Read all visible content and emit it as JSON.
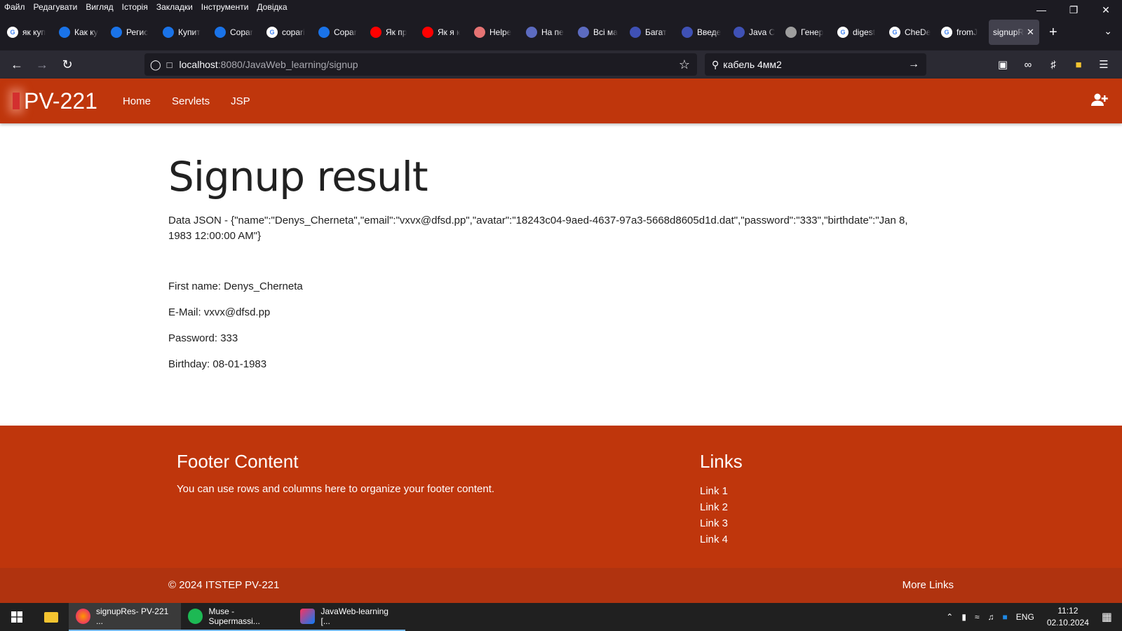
{
  "menu": [
    "Файл",
    "Редагувати",
    "Вигляд",
    "Історія",
    "Закладки",
    "Інструменти",
    "Довідка"
  ],
  "tabs": [
    {
      "title": "як куп",
      "color": "#ffffff",
      "icon": "google-icon"
    },
    {
      "title": "Как ку",
      "color": "#1a73e8",
      "icon": "copilot-c-icon"
    },
    {
      "title": "Регис",
      "color": "#1a73e8",
      "icon": "copilot-c-icon"
    },
    {
      "title": "Купит",
      "color": "#1a73e8",
      "icon": "copilot-c-icon"
    },
    {
      "title": "Copar",
      "color": "#1a73e8",
      "icon": "copilot-c-icon"
    },
    {
      "title": "copari",
      "color": "#ffffff",
      "icon": "google-icon"
    },
    {
      "title": "Copar",
      "color": "#1a73e8",
      "icon": "copilot-c-icon"
    },
    {
      "title": "Як пр",
      "color": "#ff0000",
      "icon": "youtube-icon"
    },
    {
      "title": "Як я к",
      "color": "#ff0000",
      "icon": "youtube-icon"
    },
    {
      "title": "Helpe",
      "color": "#e57373",
      "icon": "helper-icon"
    },
    {
      "title": "На пе",
      "color": "#5c6bc0",
      "icon": "m-icon"
    },
    {
      "title": "Всі ма",
      "color": "#5c6bc0",
      "icon": "m-icon"
    },
    {
      "title": "Багат",
      "color": "#3f51b5",
      "icon": "factory-icon"
    },
    {
      "title": "Введе",
      "color": "#3f51b5",
      "icon": "factory-icon"
    },
    {
      "title": "Java C",
      "color": "#3f51b5",
      "icon": "factory-icon"
    },
    {
      "title": "Генер",
      "color": "#9e9e9e",
      "icon": "openai-icon"
    },
    {
      "title": "digest",
      "color": "#ffffff",
      "icon": "google-icon"
    },
    {
      "title": "CheDe",
      "color": "#ffffff",
      "icon": "github-icon"
    },
    {
      "title": "fromJ",
      "color": "#ffffff",
      "icon": "google-icon"
    },
    {
      "title": "signupR",
      "color": "",
      "icon": ""
    }
  ],
  "address": {
    "host": "localhost",
    "path": ":8080/JavaWeb_learning/signup"
  },
  "search": {
    "query": "кабель 4мм2"
  },
  "site": {
    "brand": "PV-221",
    "nav": [
      "Home",
      "Servlets",
      "JSP"
    ],
    "accent": "#bf360c"
  },
  "page": {
    "title": "Signup result",
    "json_text": "Data JSON - {\"name\":\"Denys_Cherneta\",\"email\":\"vxvx@dfsd.pp\",\"avatar\":\"18243c04-9aed-4637-97a3-5668d8605d1d.dat\",\"password\":\"333\",\"birthdate\":\"Jan 8, 1983 12:00:00 AM\"}",
    "first_name": "First name: Denys_Cherneta",
    "email": "E-Mail: vxvx@dfsd.pp",
    "password": "Password: 333",
    "birthday": "Birthday: 08-01-1983"
  },
  "footer": {
    "title": "Footer Content",
    "text": "You can use rows and columns here to organize your footer content.",
    "links_title": "Links",
    "links": [
      "Link 1",
      "Link 2",
      "Link 3",
      "Link 4"
    ],
    "copyright": "© 2024 ITSTEP PV-221",
    "more": "More Links"
  },
  "taskbar": {
    "items": [
      "signupRes- PV-221 ...",
      "Muse - Supermassi...",
      "JavaWeb-learning [..."
    ],
    "lang": "ENG",
    "time": "11:12",
    "date": "02.10.2024"
  }
}
